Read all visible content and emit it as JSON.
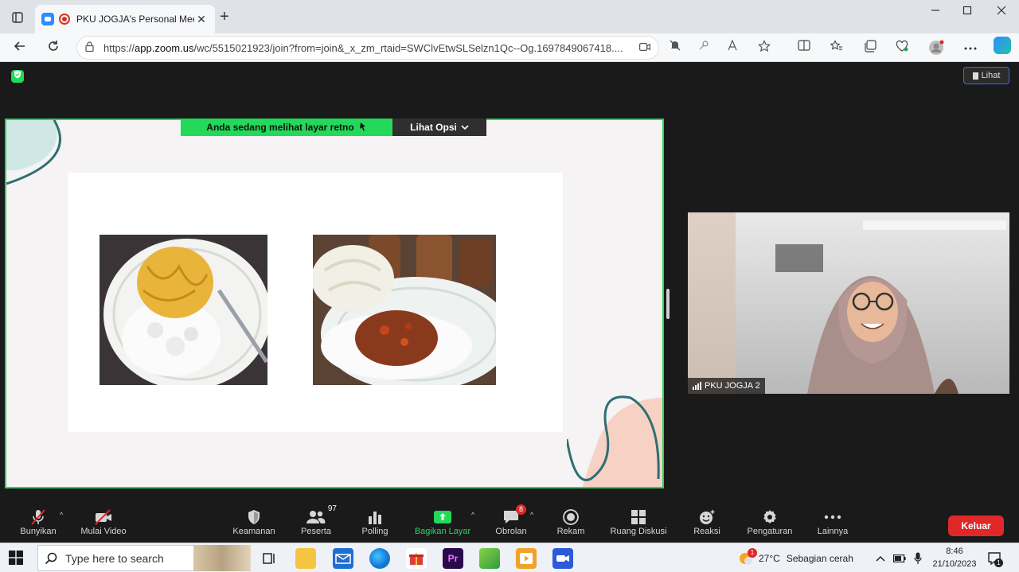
{
  "browser": {
    "tab_title": "PKU JOGJA's Personal Meeti",
    "url_prefix": "https://",
    "url_host": "app.zoom.us",
    "url_path": "/wc/5515021923/join?from=join&_x_zm_rtaid=SWClvEtwSLSelzn1Qc--Og.1697849067418....",
    "new_tab": "+",
    "close_tab": "✕"
  },
  "zoom": {
    "view_button": "Lihat",
    "share_banner": "Anda sedang melihat layar  retno",
    "view_options": "Lihat Opsi",
    "participant_name": "PKU JOGJA 2",
    "toolbar": {
      "unmute": "Bunyikan",
      "start_video": "Mulai Video",
      "security": "Keamanan",
      "participants": "Peserta",
      "participants_count": "97",
      "polling": "Polling",
      "share_screen": "Bagikan Layar",
      "chat": "Obrolan",
      "chat_badge": "8",
      "record": "Rekam",
      "breakout": "Ruang Diskusi",
      "reactions": "Reaksi",
      "settings": "Pengaturan",
      "more": "Lainnya",
      "leave": "Keluar"
    },
    "colors": {
      "active_green": "#23d959",
      "leave_red": "#e02828"
    }
  },
  "taskbar": {
    "search_placeholder": "Type here to search",
    "weather_temp": "27°C",
    "weather_text": "Sebagian cerah",
    "weather_badge": "1",
    "time": "8:46",
    "date": "21/10/2023",
    "notification_count": "1"
  }
}
